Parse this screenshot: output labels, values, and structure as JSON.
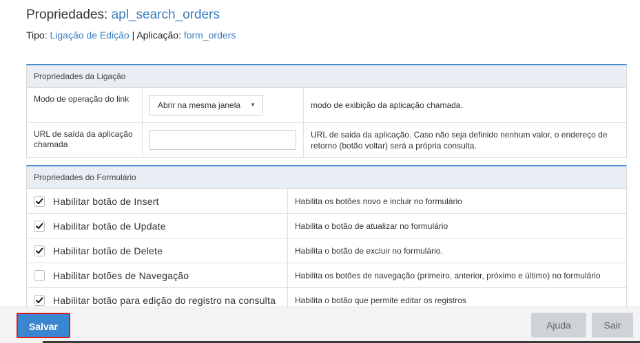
{
  "header": {
    "title_prefix": "Propriedades:",
    "title_name": "apl_search_orders",
    "type_label": "Tipo:",
    "type_value": "Ligação de Edição",
    "app_label": "| Aplicação:",
    "app_value": "form_orders"
  },
  "link_panel": {
    "title": "Propriedades da Ligação",
    "rows": [
      {
        "label": "Modo de operação do link",
        "select_value": "Abrir na mesma janela",
        "description": "modo de exibição da aplicação chamada."
      },
      {
        "label": "URL de saída da aplicação chamada",
        "input_value": "",
        "description": "URL de saida da aplicação. Caso não seja definido nenhum valor, o endereço de retorno (botão voltar) será a própria consulta."
      }
    ]
  },
  "form_panel": {
    "title": "Propriedades do Formulário",
    "rows": [
      {
        "label": "Habilitar botão de Insert",
        "checked": true,
        "description": "Habilita os botões novo e incluir no formulário"
      },
      {
        "label": "Habilitar botão de Update",
        "checked": true,
        "description": "Habilita o botão de atualizar no formulário"
      },
      {
        "label": "Habilitar botão de Delete",
        "checked": true,
        "description": "Habilita o botão de excluir no formulário."
      },
      {
        "label": "Habilitar botões de Navegação",
        "checked": false,
        "description": "Habilita os botões de navegação (primeiro, anterior, próximo e último) no formulário"
      },
      {
        "label": "Habilitar botão para edição do registro na consulta",
        "checked": true,
        "description": "Habilita o botão que permite editar os registros"
      }
    ]
  },
  "footer": {
    "save_label": "Salvar",
    "help_label": "Ajuda",
    "exit_label": "Sair"
  },
  "icons": {
    "select_caret": "caret-down-icon",
    "checkbox_mark": "checkmark-icon"
  },
  "colors": {
    "accent": "#3a7cc0",
    "primary_button": "#3a86d1",
    "highlight_border": "#e0191d",
    "panel_header": "#e9eef5"
  }
}
